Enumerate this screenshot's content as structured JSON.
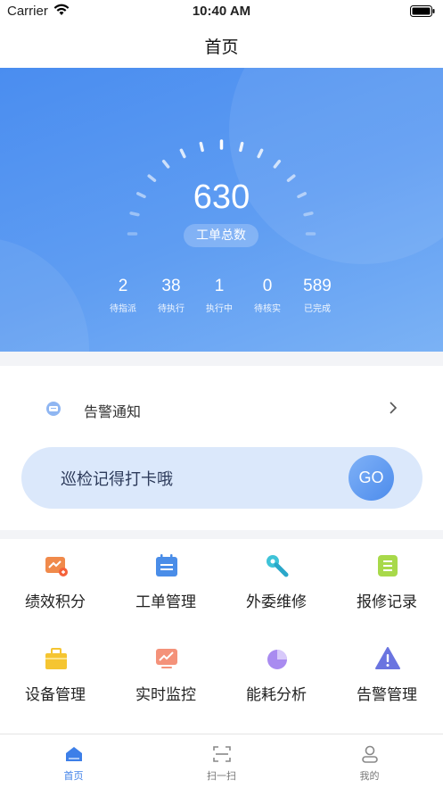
{
  "status_bar": {
    "carrier": "Carrier",
    "time": "10:40 AM"
  },
  "nav": {
    "title": "首页"
  },
  "dashboard": {
    "total_value": "630",
    "total_label": "工单总数",
    "stats": [
      {
        "value": "2",
        "label": "待指派"
      },
      {
        "value": "38",
        "label": "待执行"
      },
      {
        "value": "1",
        "label": "执行中"
      },
      {
        "value": "0",
        "label": "待核实"
      },
      {
        "value": "589",
        "label": "已完成"
      }
    ]
  },
  "notice": {
    "text": "告警通知"
  },
  "checkin": {
    "text": "巡检记得打卡哦",
    "button": "GO"
  },
  "features": [
    {
      "label": "绩效积分",
      "icon": "performance-points-icon",
      "color": "#f08a4b"
    },
    {
      "label": "工单管理",
      "icon": "work-order-calendar-icon",
      "color": "#4a8de8"
    },
    {
      "label": "外委维修",
      "icon": "wrench-icon",
      "color": "#3fc3d8"
    },
    {
      "label": "报修记录",
      "icon": "repair-record-icon",
      "color": "#a8d94a"
    },
    {
      "label": "设备管理",
      "icon": "device-box-icon",
      "color": "#f5c531"
    },
    {
      "label": "实时监控",
      "icon": "monitor-chart-icon",
      "color": "#f4927a"
    },
    {
      "label": "能耗分析",
      "icon": "pie-chart-icon",
      "color": "#a98bf0"
    },
    {
      "label": "告警管理",
      "icon": "warning-triangle-icon",
      "color": "#6a74e0"
    }
  ],
  "tabs": [
    {
      "label": "首页",
      "icon": "home-icon",
      "active": true
    },
    {
      "label": "扫一扫",
      "icon": "scan-icon",
      "active": false
    },
    {
      "label": "我的",
      "icon": "profile-icon",
      "active": false
    }
  ],
  "colors": {
    "accent": "#3d7fe8",
    "hero_start": "#4a8df0",
    "hero_end": "#7bb2f5"
  }
}
